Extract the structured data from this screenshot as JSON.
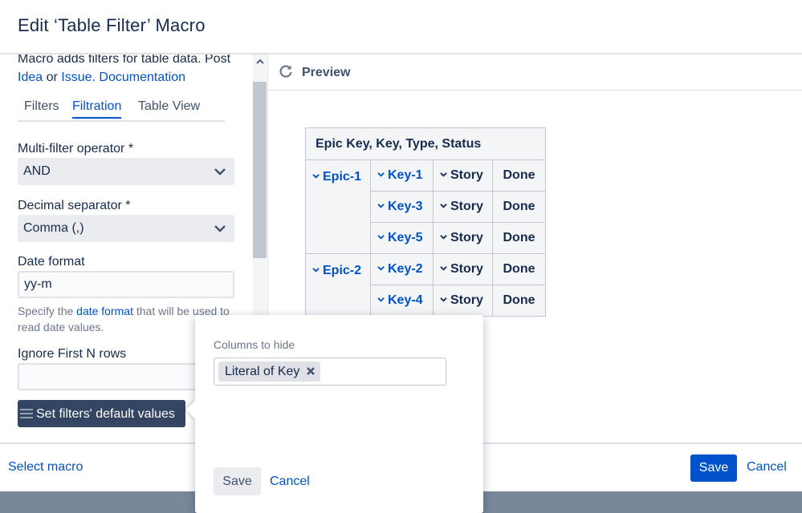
{
  "dialog": {
    "title": "Edit ‘Table Filter’ Macro"
  },
  "left": {
    "description": {
      "text_before": "Macro adds filters for table data. Post",
      "link_idea": "Idea",
      "or": " or ",
      "link_issue": "Issue.",
      "space": " ",
      "link_docs": "Documentation"
    },
    "tabs": [
      {
        "label": "Filters"
      },
      {
        "label": "Filtration"
      },
      {
        "label": "Table View"
      }
    ],
    "multi_filter": {
      "label": "Multi-filter operator *",
      "value": "AND"
    },
    "decimal": {
      "label": "Decimal separator *",
      "value": "Comma (,)"
    },
    "date_format": {
      "label": "Date format",
      "value": "yy-m"
    },
    "hint": {
      "before": "Specify the ",
      "link": "date format",
      "after": " that will be used to read date values."
    },
    "ignore_rows": {
      "label": "Ignore First N rows",
      "value": ""
    },
    "default_values_button": "Set filters' default values"
  },
  "preview": {
    "title": "Preview",
    "table": {
      "header": "Epic Key, Key, Type, Status",
      "rows": [
        {
          "epic": "Epic-1",
          "key": "Key-1",
          "type": "Story",
          "status": "Done"
        },
        {
          "epic": "",
          "key": "Key-3",
          "type": "Story",
          "status": "Done"
        },
        {
          "epic": "",
          "key": "Key-5",
          "type": "Story",
          "status": "Done"
        },
        {
          "epic": "Epic-2",
          "key": "Key-2",
          "type": "Story",
          "status": "Done"
        },
        {
          "epic": "",
          "key": "Key-4",
          "type": "Story",
          "status": "Done"
        }
      ]
    }
  },
  "popup": {
    "label": "Columns to hide",
    "chip": "Literal of Key",
    "save": "Save",
    "cancel": "Cancel"
  },
  "footer": {
    "select_macro": "Select macro",
    "save": "Save",
    "cancel": "Cancel"
  },
  "colors": {
    "primary": "#0052cc",
    "dark_button": "#344563",
    "text": "#172b4d"
  },
  "icons": [
    "chevron-down-icon",
    "refresh-icon",
    "menu-icon",
    "close-icon",
    "scroll-up-icon"
  ]
}
